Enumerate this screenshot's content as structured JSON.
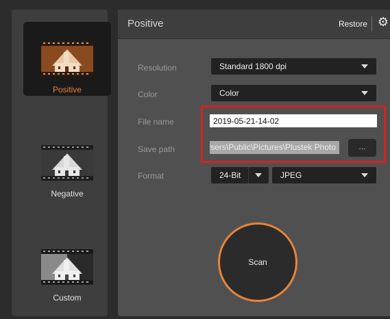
{
  "sidebar": {
    "items": [
      {
        "label": "Positive",
        "active": true
      },
      {
        "label": "Negative",
        "active": false
      },
      {
        "label": "Custom",
        "active": false
      }
    ]
  },
  "header": {
    "title": "Positive",
    "restore_label": "Restore",
    "settings_icon": "gear-icon"
  },
  "form": {
    "resolution": {
      "label": "Resolution",
      "value": "Standard 1800 dpi"
    },
    "color": {
      "label": "Color",
      "value": "Color"
    },
    "file_name": {
      "label": "File name",
      "value": "2019-05-21-14-02"
    },
    "save_path": {
      "label": "Save path",
      "value": "C:\\Users\\Public\\Pictures\\Plustek Photo",
      "browse_label": "..."
    },
    "format": {
      "label": "Format",
      "bit_depth": "24-Bit",
      "file_type": "JPEG"
    }
  },
  "scan": {
    "label": "Scan"
  },
  "colors": {
    "accent": "#e8843a",
    "highlight": "#d72025",
    "panel": "#505050",
    "sidebar": "#3e3e3e"
  }
}
